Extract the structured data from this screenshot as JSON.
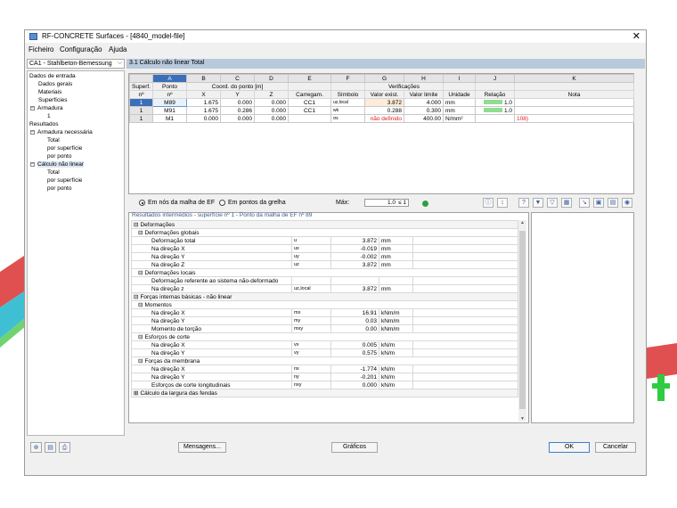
{
  "window": {
    "title": "RF-CONCRETE Surfaces - [4840_model-file]"
  },
  "menu": [
    "Ficheiro",
    "Configuração",
    "Ajuda"
  ],
  "case_select": "CA1 - Stahlbeton-Bemessung",
  "section_title": "3.1 Cálculo não linear Total",
  "nav": {
    "items": [
      {
        "label": "Dados de entrada",
        "level": 0
      },
      {
        "label": "Dados gerais",
        "level": 1
      },
      {
        "label": "Materiais",
        "level": 1
      },
      {
        "label": "Superfícies",
        "level": 1
      },
      {
        "label": "Armadura",
        "level": 1
      },
      {
        "label": "1",
        "level": 2
      },
      {
        "label": "Resultados",
        "level": 0
      },
      {
        "label": "Armadura necessária",
        "level": 1
      },
      {
        "label": "Total",
        "level": 2
      },
      {
        "label": "por superfície",
        "level": 2
      },
      {
        "label": "por ponto",
        "level": 2
      },
      {
        "label": "Cálculo não linear",
        "level": 1
      },
      {
        "label": "Total",
        "level": 2
      },
      {
        "label": "por superfície",
        "level": 2
      },
      {
        "label": "por ponto",
        "level": 2
      }
    ]
  },
  "table": {
    "col_letters": [
      "A",
      "B",
      "C",
      "D",
      "E",
      "F",
      "G",
      "H",
      "I",
      "J",
      "K"
    ],
    "group_coords": "Coord. do ponto [m]",
    "group_verif": "Verificações",
    "header": {
      "superf1": "Superf.",
      "superf2": "nº",
      "ponto1": "Ponto",
      "ponto2": "nº",
      "x": "X",
      "y": "Y",
      "z": "Z",
      "carreg": "Carregam.",
      "simb": "Símbolo",
      "valor": "Valor exist.",
      "limite": "Valor limite",
      "unid": "Unidade",
      "rel": "Relação",
      "nota": "Nota"
    },
    "rows": [
      {
        "surf": "1",
        "point": "M89",
        "x": "1.675",
        "y": "0.000",
        "z": "0.000",
        "load": "CC1",
        "sym": "uz,local",
        "val": "3.872",
        "lim": "4.000",
        "unit": "mm",
        "ratio": "1.0",
        "ratio_frac": 0.97,
        "note": ""
      },
      {
        "surf": "1",
        "point": "M91",
        "x": "1.675",
        "y": "0.286",
        "z": "0.000",
        "load": "CC1",
        "sym": "wk",
        "val": "0.288",
        "lim": "0.300",
        "unit": "mm",
        "ratio": "1.0",
        "ratio_frac": 0.96,
        "note": ""
      },
      {
        "surf": "1",
        "point": "M1",
        "x": "0.000",
        "y": "0.000",
        "z": "0.000",
        "load": "",
        "sym": "σs",
        "val": "não definido",
        "lim": "400.00",
        "unit": "N/mm²",
        "ratio": "",
        "ratio_frac": 0,
        "note": "108)"
      }
    ]
  },
  "options": {
    "radio1": "Em nós da malha de EF",
    "radio2": "Em pontos da grelha",
    "max_label": "Máx:",
    "max_value": "1.0",
    "max_cond": "≤ 1"
  },
  "results": {
    "title": "Resultados intermédios  -  superfície nº 1 - Ponto da malha de EF nº 89",
    "rows": [
      {
        "type": "group",
        "label": "Deformações",
        "indent": 0
      },
      {
        "type": "group",
        "label": "Deformações globais",
        "indent": 1
      },
      {
        "type": "data",
        "label": "Deformação total",
        "sym": "u",
        "val": "3.872",
        "unit": "mm"
      },
      {
        "type": "data",
        "label": "Na direção X",
        "sym": "ux",
        "val": "-0.019",
        "unit": "mm"
      },
      {
        "type": "data",
        "label": "Na direção Y",
        "sym": "uy",
        "val": "-0.002",
        "unit": "mm"
      },
      {
        "type": "data",
        "label": "Na direção Z",
        "sym": "uz",
        "val": "3.872",
        "unit": "mm"
      },
      {
        "type": "group",
        "label": "Deformações locais",
        "indent": 1
      },
      {
        "type": "data",
        "label": "Deformação referente ao sistema não-deformado",
        "sym": "",
        "val": "",
        "unit": ""
      },
      {
        "type": "data",
        "label": "Na direção z",
        "sym": "uz,local",
        "val": "3.872",
        "unit": "mm"
      },
      {
        "type": "group",
        "label": "Forças internas básicas - não linear",
        "indent": 0
      },
      {
        "type": "group",
        "label": "Momentos",
        "indent": 1
      },
      {
        "type": "data",
        "label": "Na direção X",
        "sym": "mx",
        "val": "16.91",
        "unit": "kNm/m"
      },
      {
        "type": "data",
        "label": "Na direção Y",
        "sym": "my",
        "val": "0.03",
        "unit": "kNm/m"
      },
      {
        "type": "data",
        "label": "Momento de torção",
        "sym": "mxy",
        "val": "0.00",
        "unit": "kNm/m"
      },
      {
        "type": "group",
        "label": "Esforços de corte",
        "indent": 1
      },
      {
        "type": "data",
        "label": "Na direção X",
        "sym": "vx",
        "val": "0.005",
        "unit": "kN/m"
      },
      {
        "type": "data",
        "label": "Na direção Y",
        "sym": "vy",
        "val": "0.575",
        "unit": "kN/m"
      },
      {
        "type": "group",
        "label": "Forças da membrana",
        "indent": 1
      },
      {
        "type": "data",
        "label": "Na direção X",
        "sym": "nx",
        "val": "-1.774",
        "unit": "kN/m"
      },
      {
        "type": "data",
        "label": "Na direção Y",
        "sym": "ny",
        "val": "-0.201",
        "unit": "kN/m"
      },
      {
        "type": "data",
        "label": "Esforços de corte longitudinais",
        "sym": "nxy",
        "val": "0.000",
        "unit": "kN/m"
      },
      {
        "type": "group",
        "label": "Cálculo da largura das fendas",
        "indent": 0,
        "collapsed": true
      }
    ]
  },
  "buttons": {
    "messages": "Mensagens...",
    "graphics": "Gráficos",
    "ok": "OK",
    "cancel": "Cancelar"
  }
}
